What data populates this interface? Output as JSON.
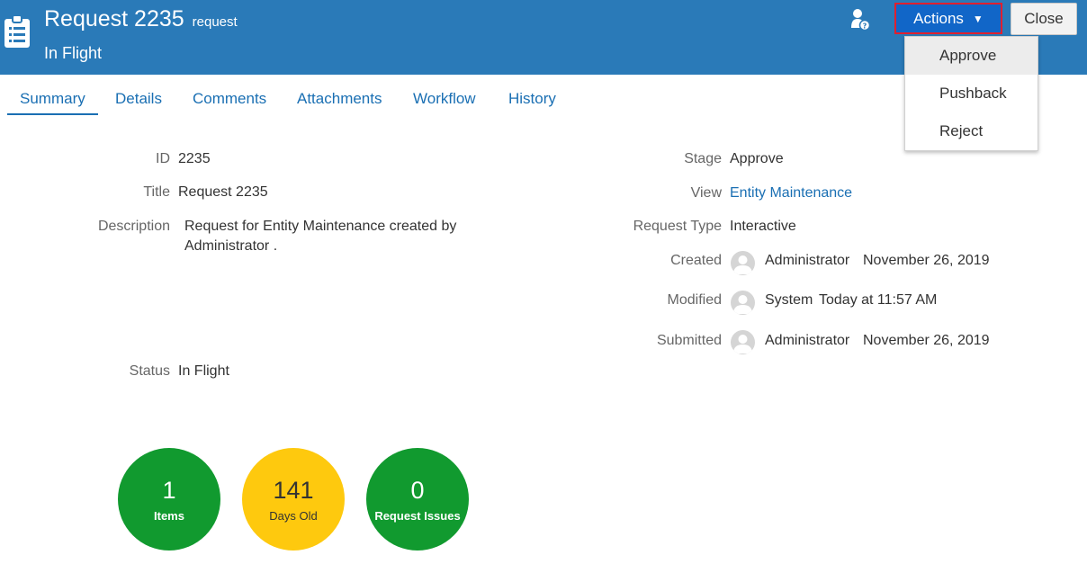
{
  "header": {
    "title": "Request 2235",
    "subtitle": "request",
    "status": "In Flight",
    "actions_label": "Actions",
    "close_label": "Close",
    "bg_color": "#2a7ab8"
  },
  "actions_menu": [
    "Approve",
    "Pushback",
    "Reject"
  ],
  "tabs": [
    "Summary",
    "Details",
    "Comments",
    "Attachments",
    "Workflow",
    "History"
  ],
  "left_fields": {
    "id_label": "ID",
    "id_value": "2235",
    "title_label": "Title",
    "title_value": "Request 2235",
    "description_label": "Description",
    "description_value": "Request for Entity Maintenance created by Administrator .",
    "status_label": "Status",
    "status_value": "In Flight"
  },
  "right_fields": {
    "stage_label": "Stage",
    "stage_value": "Approve",
    "view_label": "View",
    "view_value": "Entity Maintenance",
    "type_label": "Request Type",
    "type_value": "Interactive",
    "created_label": "Created",
    "created_user": "Administrator",
    "created_date": "November 26, 2019",
    "modified_label": "Modified",
    "modified_user": "System",
    "modified_date": "Today at 11:57 AM",
    "submitted_label": "Submitted",
    "submitted_user": "Administrator",
    "submitted_date": "November 26, 2019"
  },
  "metrics": [
    {
      "value": "1",
      "label": "Items",
      "color": "#119a2f"
    },
    {
      "value": "141",
      "label": "Days Old",
      "color": "#fec90e"
    },
    {
      "value": "0",
      "label": "Request Issues",
      "color": "#119a2f"
    }
  ]
}
